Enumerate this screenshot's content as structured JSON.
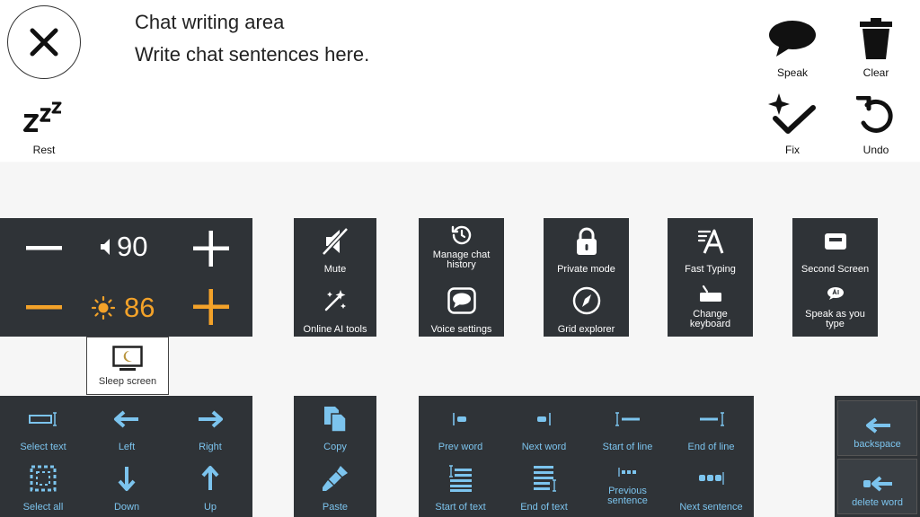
{
  "chat": {
    "title": "Chat writing area",
    "hint": "Write chat sentences here."
  },
  "top_tools": {
    "speak": "Speak",
    "clear": "Clear",
    "fix": "Fix",
    "undo": "Undo",
    "rest": "Rest"
  },
  "levels": {
    "volume": "90",
    "brightness": "86"
  },
  "menu": {
    "mute": "Mute",
    "online_ai_tools": "Online AI tools",
    "manage_chat_history_1": "Manage chat",
    "manage_chat_history_2": "history",
    "voice_settings": "Voice settings",
    "private_mode": "Private mode",
    "grid_explorer": "Grid explorer",
    "fast_typing": "Fast Typing",
    "change_keyboard_1": "Change",
    "change_keyboard_2": "keyboard",
    "second_screen": "Second Screen",
    "speak_as_you_type_1": "Speak as you",
    "speak_as_you_type_2": "type"
  },
  "sleep": {
    "label": "Sleep screen"
  },
  "nav": {
    "select_text": "Select text",
    "left": "Left",
    "right": "Right",
    "select_all": "Select all",
    "down": "Down",
    "up": "Up"
  },
  "clipboard": {
    "copy": "Copy",
    "paste": "Paste"
  },
  "cursor": {
    "prev_word": "Prev word",
    "next_word": "Next word",
    "start_of_line": "Start of line",
    "end_of_line": "End of line",
    "start_of_text": "Start of text",
    "end_of_text": "End of text",
    "previous_sentence_1": "Previous",
    "previous_sentence_2": "sentence",
    "next_sentence": "Next sentence"
  },
  "delete": {
    "backspace": "backspace",
    "delete_word": "delete word"
  },
  "colors": {
    "panel": "#2f3337",
    "accent_blue": "#7cc4ee",
    "accent_orange": "#f3a229"
  }
}
